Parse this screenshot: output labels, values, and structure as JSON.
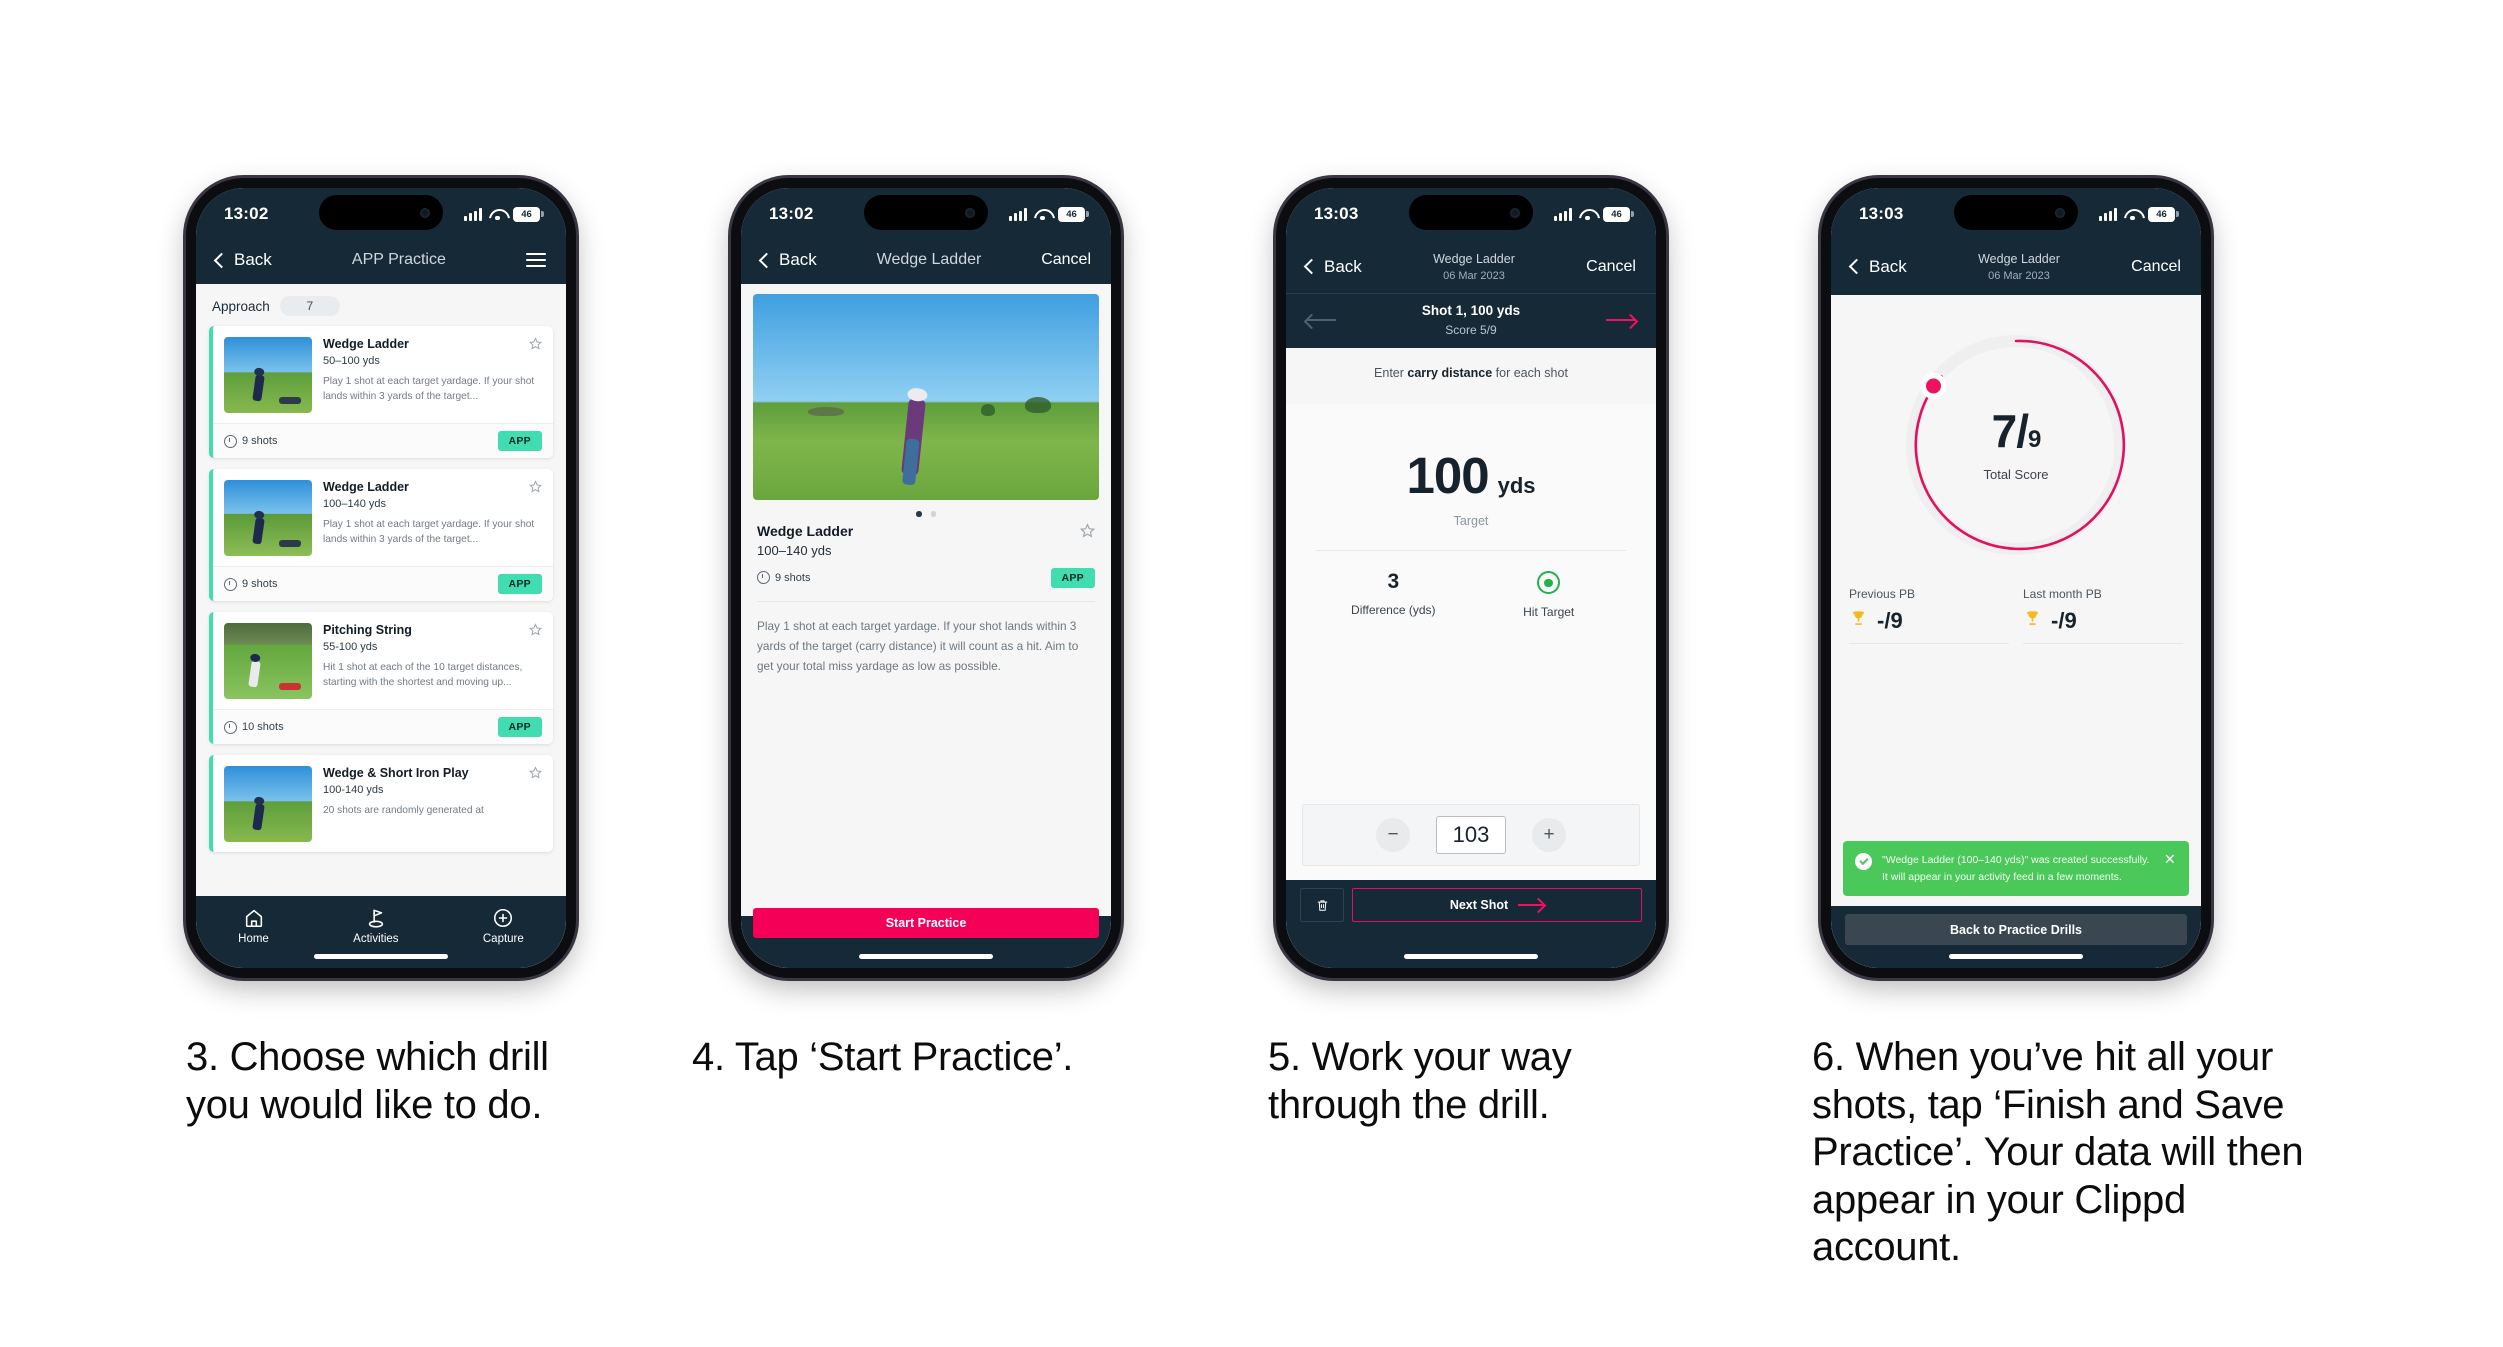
{
  "steps": [
    {
      "caption": "3. Choose which drill you would like to do.",
      "status": {
        "time": "13:02",
        "battery": "46"
      },
      "nav": {
        "back": "Back",
        "title": "APP Practice",
        "menu_icon": "hamburger-icon"
      },
      "section": {
        "label": "Approach",
        "count": "7"
      },
      "drills": [
        {
          "title": "Wedge Ladder",
          "range": "50–100 yds",
          "desc": "Play 1 shot at each target yardage. If your shot lands within 3 yards of the target...",
          "shots": "9 shots",
          "badge": "APP"
        },
        {
          "title": "Wedge Ladder",
          "range": "100–140 yds",
          "desc": "Play 1 shot at each target yardage. If your shot lands within 3 yards of the target...",
          "shots": "9 shots",
          "badge": "APP"
        },
        {
          "title": "Pitching String",
          "range": "55-100 yds",
          "desc": "Hit 1 shot at each of the 10 target distances, starting with the shortest and moving up...",
          "shots": "10 shots",
          "badge": "APP"
        },
        {
          "title": "Wedge & Short Iron Play",
          "range": "100-140 yds",
          "desc": "20 shots are randomly generated at",
          "shots": "",
          "badge": ""
        }
      ],
      "tabs": [
        {
          "label": "Home",
          "icon": "home-icon"
        },
        {
          "label": "Activities",
          "icon": "golf-flag-icon"
        },
        {
          "label": "Capture",
          "icon": "plus-circle-icon"
        }
      ]
    },
    {
      "caption": "4. Tap ‘Start Practice’.",
      "status": {
        "time": "13:02",
        "battery": "46"
      },
      "nav": {
        "back": "Back",
        "title": "Wedge Ladder",
        "cancel": "Cancel"
      },
      "drill": {
        "title": "Wedge Ladder",
        "range": "100–140 yds",
        "shots": "9 shots",
        "badge": "APP",
        "desc": "Play 1 shot at each target yardage. If your shot lands within 3 yards of the target (carry distance) it will count as a hit. Aim to get your total miss yardage as low as possible."
      },
      "cta": "Start Practice"
    },
    {
      "caption": "5. Work your way through the drill.",
      "status": {
        "time": "13:03",
        "battery": "46"
      },
      "nav": {
        "back": "Back",
        "title": "Wedge Ladder",
        "subtitle": "06 Mar 2023",
        "cancel": "Cancel"
      },
      "shot_strip": {
        "title": "Shot 1, 100 yds",
        "score": "Score 5/9"
      },
      "hint_pre": "Enter ",
      "hint_bold": "carry distance",
      "hint_post": " for each shot",
      "target": {
        "value": "100",
        "unit": "yds",
        "caption": "Target"
      },
      "stats": [
        {
          "value": "3",
          "caption": "Difference (yds)"
        },
        {
          "value": "",
          "caption": "Hit Target"
        }
      ],
      "stepper": {
        "minus": "−",
        "value": "103",
        "plus": "+"
      },
      "next": "Next Shot",
      "trash_icon": "trash-icon"
    },
    {
      "caption": "6. When you’ve hit all your shots, tap ‘Finish and Save Practice’. Your data will then appear in your Clippd account.",
      "status": {
        "time": "13:03",
        "battery": "46"
      },
      "nav": {
        "back": "Back",
        "title": "Wedge Ladder",
        "subtitle": "06 Mar 2023",
        "cancel": "Cancel"
      },
      "ring": {
        "score": "7",
        "slash": "/",
        "total": "9",
        "caption": "Total Score"
      },
      "pbs": [
        {
          "header": "Previous PB",
          "value": "-/9",
          "icon": "trophy-icon"
        },
        {
          "header": "Last month PB",
          "value": "-/9",
          "icon": "trophy-icon"
        }
      ],
      "toast": {
        "text": "\"Wedge Ladder (100–140 yds)\" was created successfully. It will appear in your activity feed in a few moments.",
        "close_icon": "close-icon",
        "check_icon": "check-icon"
      },
      "cta": "Back to Practice Drills"
    }
  ],
  "colors": {
    "header": "#152937",
    "pink": "#f50057",
    "teal": "#41dcaf",
    "green": "#4bc85a",
    "ring": "#e0115f"
  }
}
